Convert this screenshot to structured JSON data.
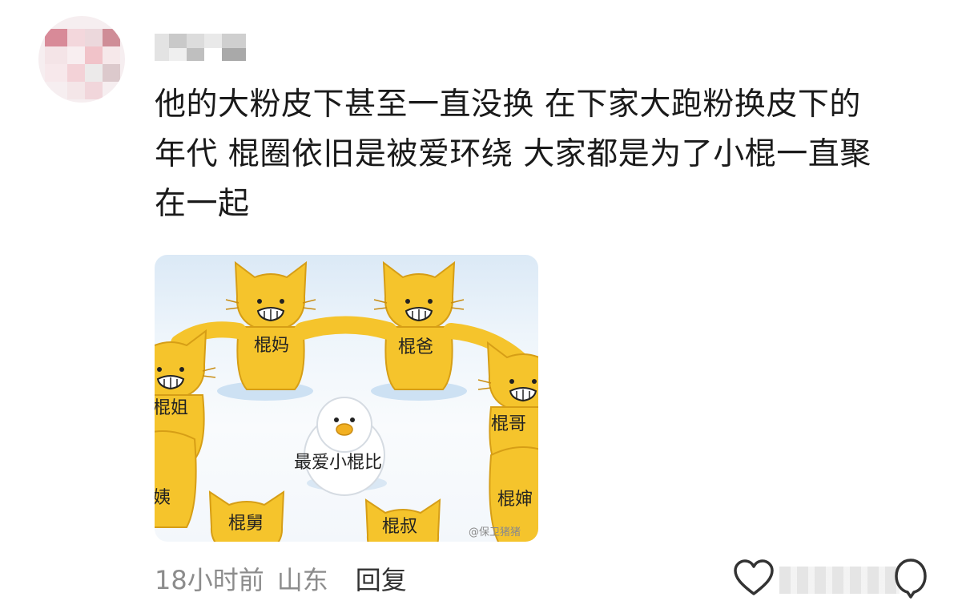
{
  "comment": {
    "author_avatar": "pixelated-avatar",
    "author_name": "",
    "text_lines": [
      "他的大粉皮下甚至一直没换 在下家大跑粉换皮下的",
      "年代 棍圈依旧是被爱环绕 大家都是为了小棍一直聚",
      "在一起"
    ]
  },
  "image": {
    "center_label": "最爱小棍比",
    "cat_labels": {
      "mom": "棍妈",
      "dad": "棍爸",
      "sister": "棍姐",
      "brother": "棍哥",
      "aunt_left": "姨",
      "aunt_right": "棍婶",
      "uncle_maternal": "棍舅",
      "uncle_paternal": "棍叔"
    },
    "watermark": "@保卫猪猪"
  },
  "footer": {
    "time": "18小时前",
    "location": "山东",
    "reply_label": "回复"
  },
  "icons": {
    "like": "heart-icon",
    "comment": "comment-bubble-icon"
  },
  "colors": {
    "cat_yellow": "#f5c42c",
    "text": "#1a1a1a",
    "meta": "#8c8c8c"
  }
}
